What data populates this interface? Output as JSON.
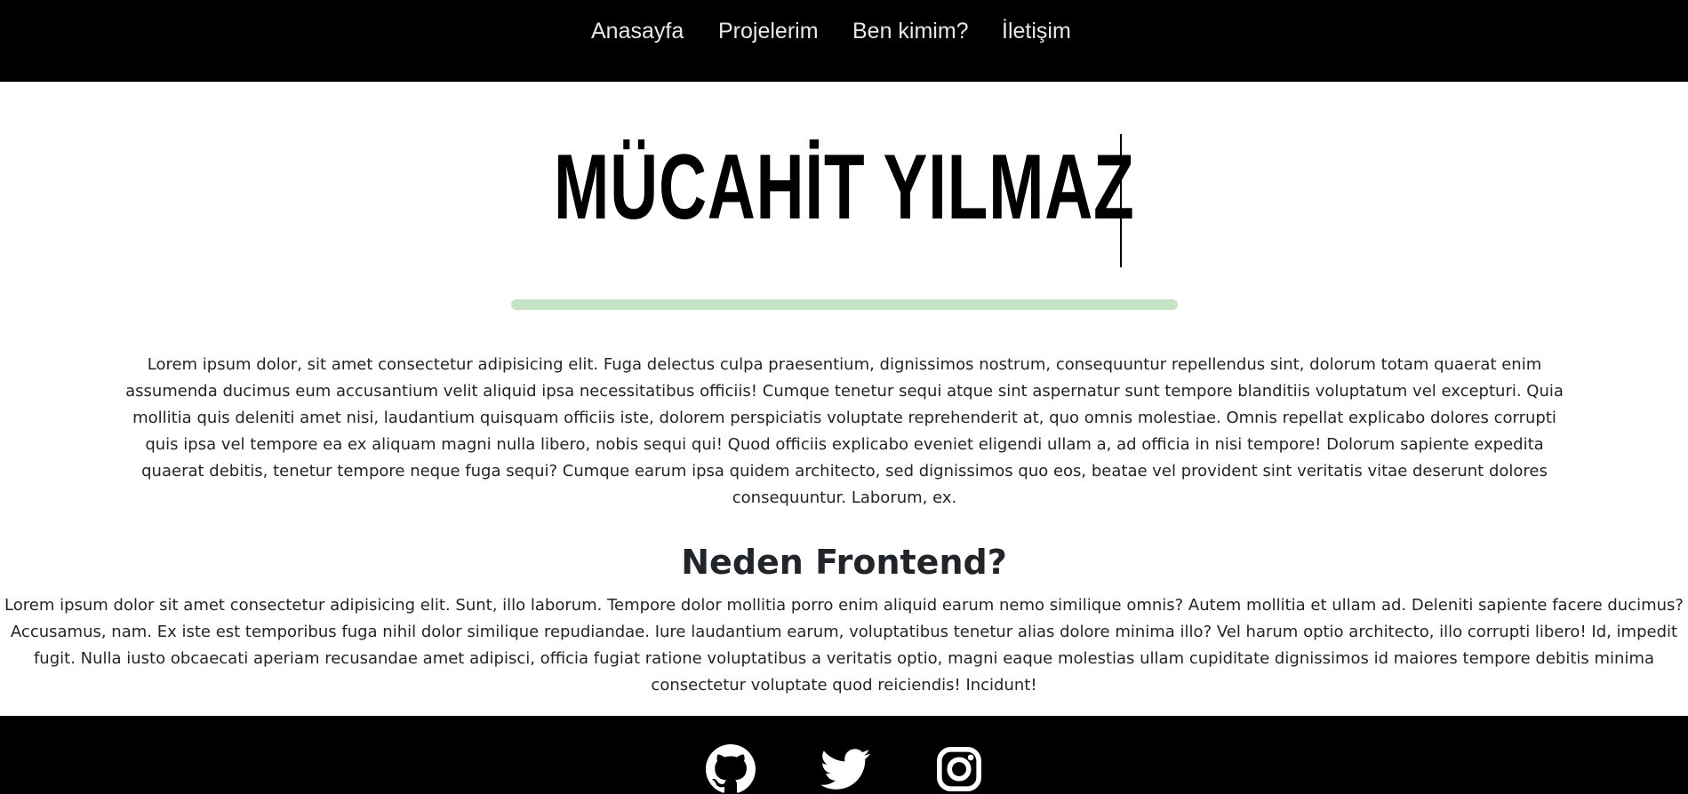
{
  "nav": {
    "items": [
      {
        "label": "Anasayfa"
      },
      {
        "label": "Projelerim"
      },
      {
        "label": "Ben kimim?"
      },
      {
        "label": "İletişim"
      }
    ]
  },
  "hero": {
    "title": "MÜCAHİT YILMAZ",
    "accent_color": "#c5e4c6"
  },
  "intro": {
    "text": "Lorem ipsum dolor, sit amet consectetur adipisicing elit. Fuga delectus culpa praesentium, dignissimos nostrum, consequuntur repellendus sint, dolorum totam quaerat enim assumenda ducimus eum accusantium velit aliquid ipsa necessitatibus officiis! Cumque tenetur sequi atque sint aspernatur sunt tempore blanditiis voluptatum vel excepturi. Quia mollitia quis deleniti amet nisi, laudantium quisquam officiis iste, dolorem perspiciatis voluptate reprehenderit at, quo omnis molestiae. Omnis repellat explicabo dolores corrupti quis ipsa vel tempore ea ex aliquam magni nulla libero, nobis sequi qui! Quod officiis explicabo eveniet eligendi ullam a, ad officia in nisi tempore! Dolorum sapiente expedita quaerat debitis, tenetur tempore neque fuga sequi? Cumque earum ipsa quidem architecto, sed dignissimos quo eos, beatae vel provident sint veritatis vitae deserunt dolores consequuntur. Laborum, ex."
  },
  "section": {
    "title": "Neden Frontend?",
    "text": "Lorem ipsum dolor sit amet consectetur adipisicing elit. Sunt, illo laborum. Tempore dolor mollitia porro enim aliquid earum nemo similique omnis? Autem mollitia et ullam ad. Deleniti sapiente facere ducimus? Accusamus, nam. Ex iste est temporibus fuga nihil dolor similique repudiandae. Iure laudantium earum, voluptatibus tenetur alias dolore minima illo? Vel harum optio architecto, illo corrupti libero! Id, impedit fugit. Nulla iusto obcaecati aperiam recusandae amet adipisci, officia fugiat ratione voluptatibus a veritatis optio, magni eaque molestias ullam cupiditate dignissimos id maiores tempore debitis minima consectetur voluptate quod reiciendis! Incidunt!"
  },
  "footer": {
    "social": [
      {
        "icon": "github-icon"
      },
      {
        "icon": "twitter-icon"
      },
      {
        "icon": "instagram-icon"
      }
    ]
  },
  "colors": {
    "nav_background": "#000000",
    "footer_background": "#000000",
    "nav_text": "#e8e8e8",
    "body_text": "#212529"
  }
}
